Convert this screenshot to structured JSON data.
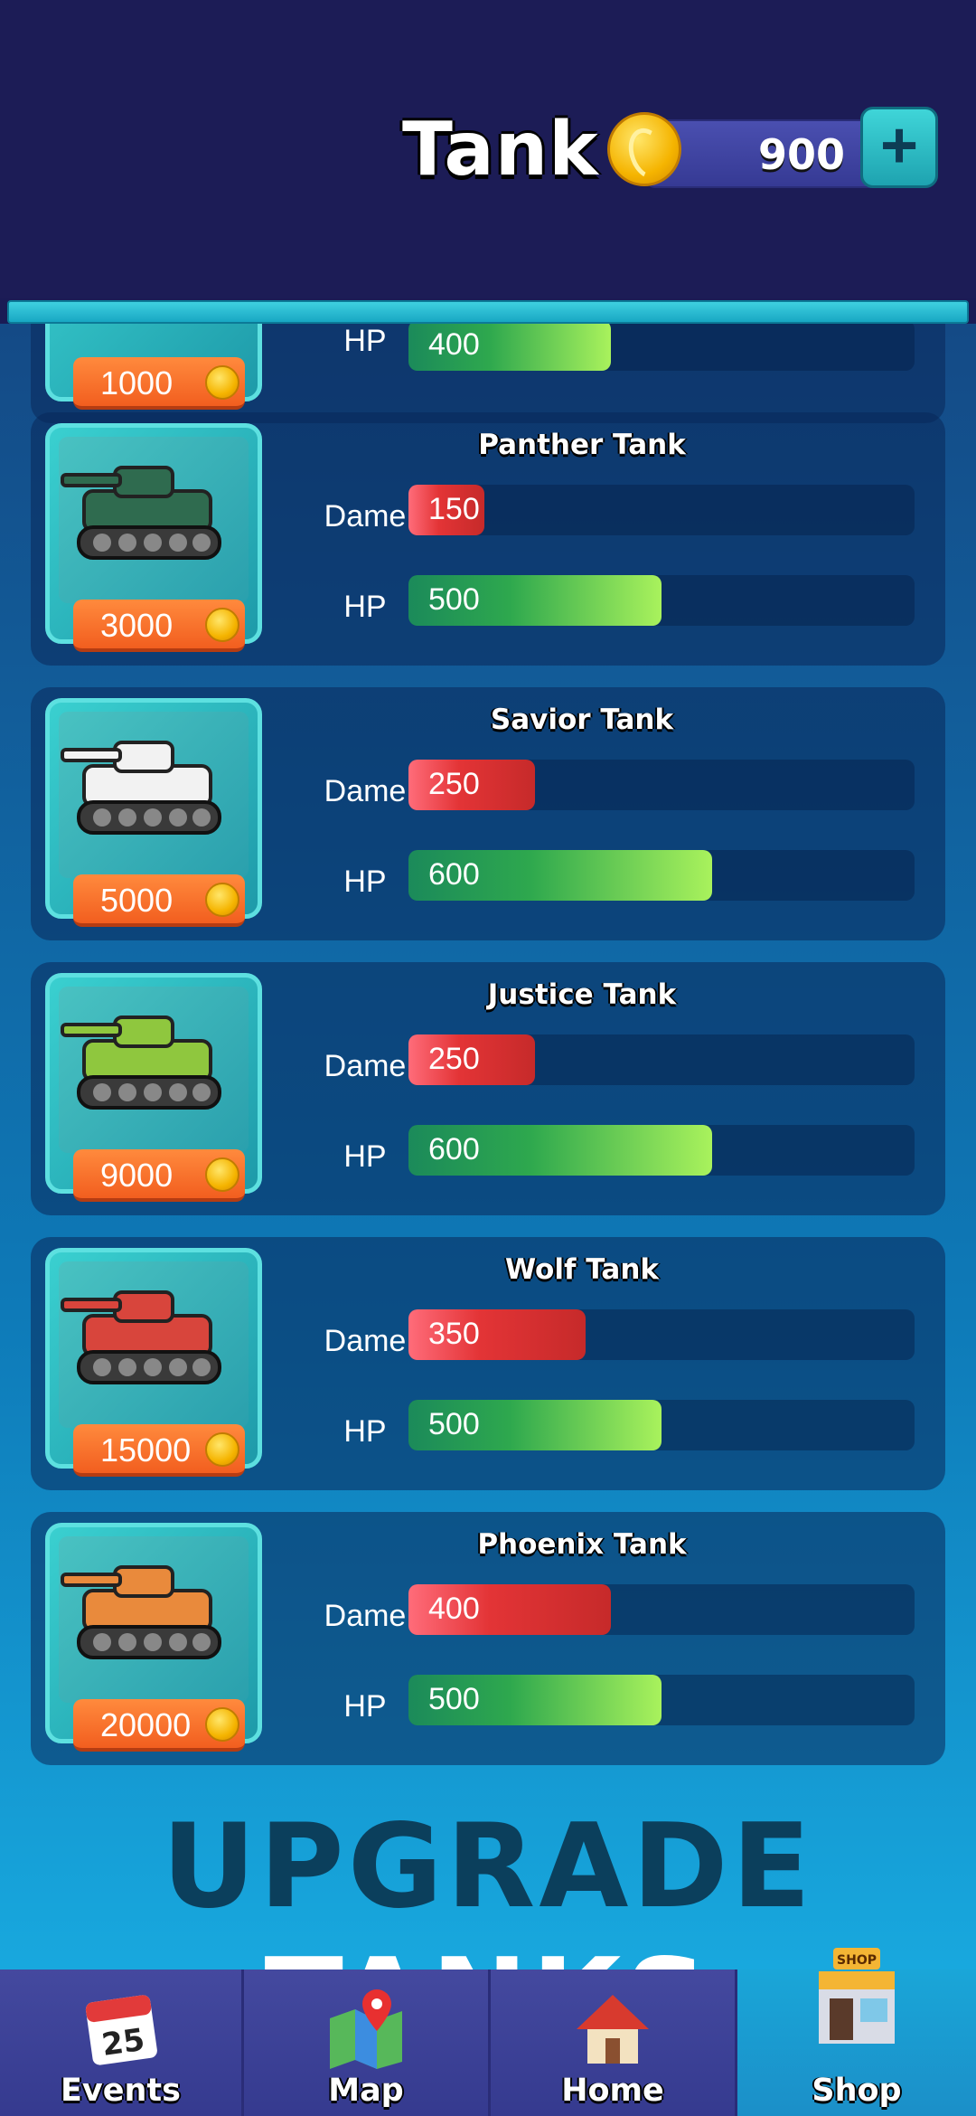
{
  "header": {
    "title": "Tank",
    "coins": "900",
    "add_icon": "plus-icon"
  },
  "partial_top_card": {
    "price": "1000",
    "hp_label": "HP",
    "hp_value": "400"
  },
  "tanks": [
    {
      "name": "Panther Tank",
      "price": "3000",
      "dame_label": "Dame",
      "dame": "150",
      "dame_fill": 0.15,
      "hp_label": "HP",
      "hp": "500",
      "hp_fill": 0.5,
      "body_color": "#2f6b4f"
    },
    {
      "name": "Savior Tank",
      "price": "5000",
      "dame_label": "Dame",
      "dame": "250",
      "dame_fill": 0.25,
      "hp_label": "HP",
      "hp": "600",
      "hp_fill": 0.6,
      "body_color": "#f2f2f2"
    },
    {
      "name": "Justice Tank",
      "price": "9000",
      "dame_label": "Dame",
      "dame": "250",
      "dame_fill": 0.25,
      "hp_label": "HP",
      "hp": "600",
      "hp_fill": 0.6,
      "body_color": "#8fc73e"
    },
    {
      "name": "Wolf Tank",
      "price": "15000",
      "dame_label": "Dame",
      "dame": "350",
      "dame_fill": 0.35,
      "hp_label": "HP",
      "hp": "500",
      "hp_fill": 0.5,
      "body_color": "#d8453c"
    },
    {
      "name": "Phoenix Tank",
      "price": "20000",
      "dame_label": "Dame",
      "dame": "400",
      "dame_fill": 0.4,
      "hp_label": "HP",
      "hp": "500",
      "hp_fill": 0.5,
      "body_color": "#e98a3c"
    }
  ],
  "banner": {
    "word1": "UPGRADE",
    "word2": "TANKS"
  },
  "nav": [
    {
      "label": "Events",
      "icon": "calendar-icon",
      "badge": "25",
      "active": false
    },
    {
      "label": "Map",
      "icon": "map-icon",
      "active": false
    },
    {
      "label": "Home",
      "icon": "home-icon",
      "active": false
    },
    {
      "label": "Shop",
      "icon": "shop-icon",
      "badge": "SHOP",
      "active": true
    }
  ]
}
